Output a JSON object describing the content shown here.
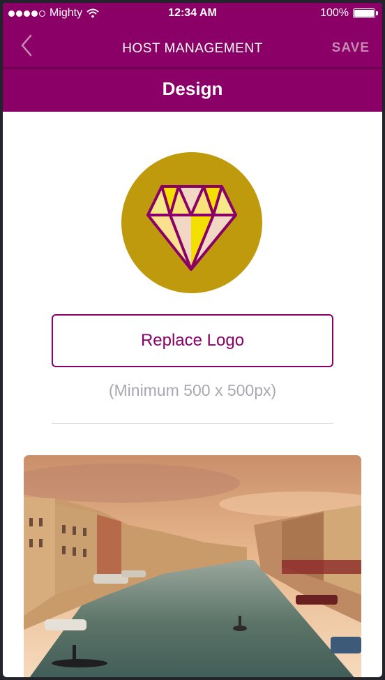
{
  "status_bar": {
    "carrier": "Mighty",
    "time": "12:34 AM",
    "battery": "100%"
  },
  "nav": {
    "title": "HOST MANAGEMENT",
    "save_label": "SAVE"
  },
  "section": {
    "title": "Design"
  },
  "logo": {
    "icon": "diamond-icon",
    "circle_color": "#bf9a0c"
  },
  "replace_button": {
    "label": "Replace Logo"
  },
  "hint": {
    "text": "(Minimum 500 x 500px)"
  },
  "background_image": {
    "icon": "venice-canal-photo"
  },
  "colors": {
    "brand": "#8a0066",
    "hint_gray": "#a8a8ae"
  }
}
